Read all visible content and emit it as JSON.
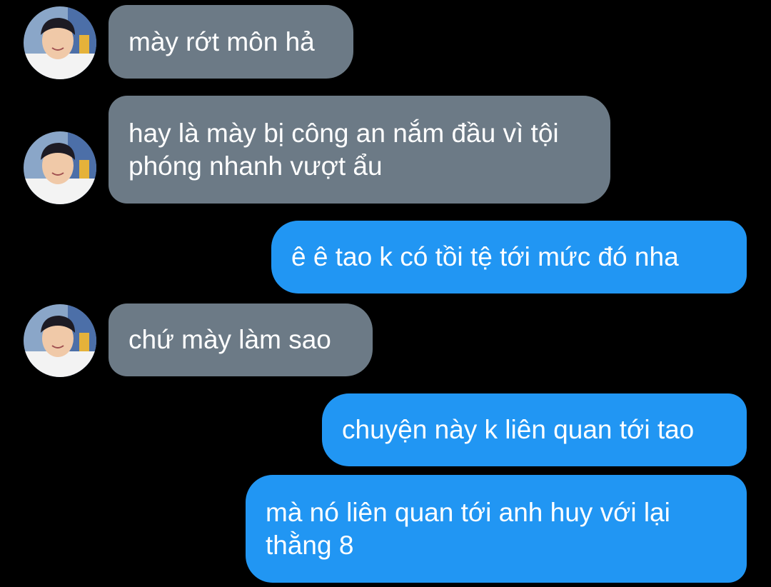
{
  "messages": [
    {
      "sender": "them",
      "text": "mày rớt môn hả"
    },
    {
      "sender": "them",
      "text": "hay là mày bị công an nắm đầu vì tội phóng nhanh vượt ẩu"
    },
    {
      "sender": "me",
      "text": "ê ê tao k có tồi tệ tới mức đó nha"
    },
    {
      "sender": "them",
      "text": "chứ mày làm sao"
    },
    {
      "sender": "me",
      "text": "chuyện này k liên quan tới tao"
    },
    {
      "sender": "me",
      "text": "mà nó liên quan tới anh huy với lại thằng 8"
    }
  ],
  "colors": {
    "background": "#000000",
    "incoming_bubble": "#6c7a86",
    "outgoing_bubble": "#2196f3",
    "text": "#ffffff"
  },
  "icons": {
    "avatar": "contact-avatar-photo"
  }
}
